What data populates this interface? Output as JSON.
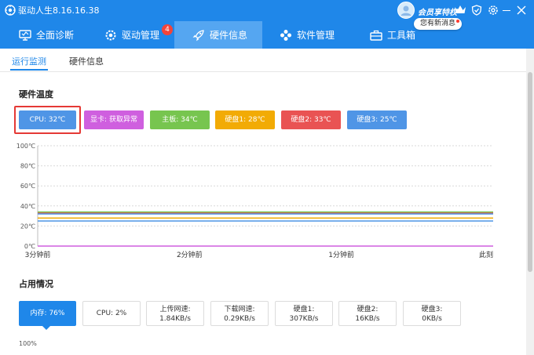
{
  "app": {
    "title": "驱动人生8.16.16.38",
    "member_label": "会员享特权",
    "message_bubble": "您有新消息"
  },
  "nav": {
    "items": [
      {
        "label": "全面诊断",
        "icon": "monitor-icon"
      },
      {
        "label": "驱动管理",
        "icon": "gear-icon",
        "badge": "4"
      },
      {
        "label": "硬件信息",
        "icon": "rocket-icon",
        "active": true
      },
      {
        "label": "软件管理",
        "icon": "apps-icon"
      },
      {
        "label": "工具箱",
        "icon": "toolbox-icon"
      }
    ]
  },
  "subtabs": [
    {
      "label": "运行监测",
      "active": true
    },
    {
      "label": "硬件信息"
    }
  ],
  "temperature": {
    "title": "硬件温度",
    "tags": [
      {
        "label": "CPU: 32℃",
        "color": "#4f95e6"
      },
      {
        "label": "显卡: 获取异常",
        "color": "#cf5fdf"
      },
      {
        "label": "主板: 34℃",
        "color": "#77c54f"
      },
      {
        "label": "硬盘1: 28℃",
        "color": "#f2ab05"
      },
      {
        "label": "硬盘2: 33℃",
        "color": "#e95353"
      },
      {
        "label": "硬盘3: 25℃",
        "color": "#4f95e6"
      }
    ]
  },
  "chart_data": {
    "type": "line",
    "y_ticks": [
      "100℃",
      "80℃",
      "60℃",
      "40℃",
      "20℃",
      "0℃"
    ],
    "x_ticks": [
      "3分钟前",
      "2分钟前",
      "1分钟前",
      "此刻"
    ],
    "ylim": [
      0,
      100
    ],
    "x": [
      0,
      20,
      30,
      40,
      50,
      60,
      70,
      80,
      90,
      100,
      110,
      120,
      130,
      140,
      150,
      160,
      170,
      180
    ],
    "series": [
      {
        "color": "#e95353",
        "values": [
          33,
          33,
          33,
          33,
          33,
          33,
          33,
          33,
          33,
          33,
          33,
          33,
          33,
          33,
          33,
          33,
          33,
          33
        ]
      },
      {
        "color": "#77c54f",
        "values": [
          34,
          34,
          34,
          34,
          34,
          34,
          34,
          34,
          34,
          34,
          34,
          34,
          34,
          34,
          34,
          34,
          34,
          34
        ]
      },
      {
        "color": "#4f95e6",
        "values": [
          32,
          32,
          32,
          32,
          32,
          32,
          32,
          32,
          32,
          32,
          32,
          32,
          32,
          32,
          32,
          32,
          32,
          32
        ]
      },
      {
        "color": "#f2ab05",
        "values": [
          28,
          28,
          28,
          28,
          28,
          28,
          28,
          28,
          28,
          28,
          28,
          28,
          28,
          28,
          28,
          28,
          28,
          28
        ]
      },
      {
        "color": "#4f95e6",
        "values": [
          25,
          25,
          25,
          25,
          25,
          25,
          25,
          25,
          25,
          25,
          25,
          25,
          25,
          25,
          25,
          25,
          25,
          25
        ]
      },
      {
        "color": "#cf5fdf",
        "values": [
          0,
          0,
          0,
          0,
          0,
          0,
          0,
          0,
          0,
          0,
          0,
          0,
          0,
          0,
          0,
          0,
          0,
          0
        ]
      }
    ]
  },
  "usage": {
    "title": "占用情况",
    "cards": [
      {
        "label": "内存: 76%",
        "active": true
      },
      {
        "label": "CPU: 2%"
      },
      {
        "label": "上传网速:",
        "value": "1.84KB/s"
      },
      {
        "label": "下载网速:",
        "value": "0.29KB/s"
      },
      {
        "label": "硬盘1:",
        "value": "307KB/s"
      },
      {
        "label": "硬盘2:",
        "value": "16KB/s"
      },
      {
        "label": "硬盘3:",
        "value": "0KB/s"
      }
    ],
    "axis_top": "100%"
  },
  "colors": {
    "primary": "#1f87e9",
    "nav_active": "#55a6f1",
    "badge": "#f2443a"
  }
}
